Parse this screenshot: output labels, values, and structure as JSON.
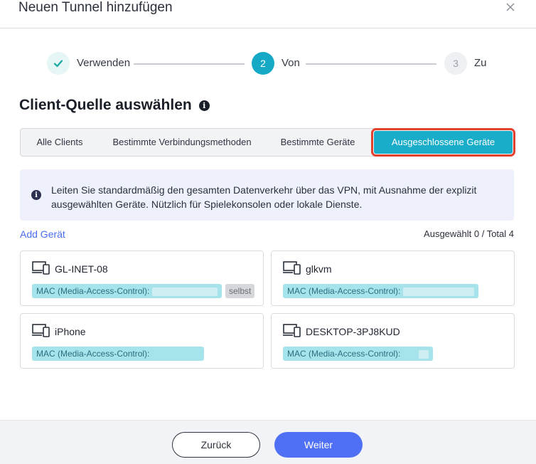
{
  "dialog": {
    "title": "Neuen Tunnel hinzufügen",
    "close_icon": "close-icon"
  },
  "stepper": {
    "steps": [
      {
        "number": "1",
        "label": "Verwenden",
        "state": "done"
      },
      {
        "number": "2",
        "label": "Von",
        "state": "active"
      },
      {
        "number": "3",
        "label": "Zu",
        "state": "todo"
      }
    ]
  },
  "section": {
    "title": "Client-Quelle auswählen",
    "info_icon": "info-icon"
  },
  "tabs": [
    {
      "label": "Alle Clients",
      "selected": false
    },
    {
      "label": "Bestimmte Verbindungsmethoden",
      "selected": false
    },
    {
      "label": "Bestimmte Geräte",
      "selected": false
    },
    {
      "label": "Ausgeschlossene Geräte",
      "selected": true
    }
  ],
  "banner": {
    "icon": "info-icon",
    "text": "Leiten Sie standardmäßig den gesamten Datenverkehr über das VPN, mit Ausnahme der explizit ausgewählten Geräte. Nützlich für Spielekonsolen oder lokale Dienste."
  },
  "devices_header": {
    "add_label": "Add Gerät",
    "selection_summary": "Ausgewählt 0 / Total 4"
  },
  "devices": [
    {
      "name": "GL-INET-08",
      "mac_label": "MAC (Media-Access-Control):",
      "badge": "selbst",
      "icon": "devices-icon"
    },
    {
      "name": "glkvm",
      "mac_label": "MAC (Media-Access-Control):",
      "badge": "",
      "icon": "devices-icon"
    },
    {
      "name": "iPhone",
      "mac_label": "MAC (Media-Access-Control):",
      "badge": "",
      "icon": "devices-icon"
    },
    {
      "name": "DESKTOP-3PJ8KUD",
      "mac_label": "MAC (Media-Access-Control):",
      "badge": "",
      "icon": "devices-icon"
    }
  ],
  "footer": {
    "back_label": "Zurück",
    "next_label": "Weiter"
  },
  "colors": {
    "accent": "#1aadca",
    "primary_button": "#4f6ff5",
    "highlight_outline": "#e2412d",
    "link": "#4a6cf0"
  }
}
